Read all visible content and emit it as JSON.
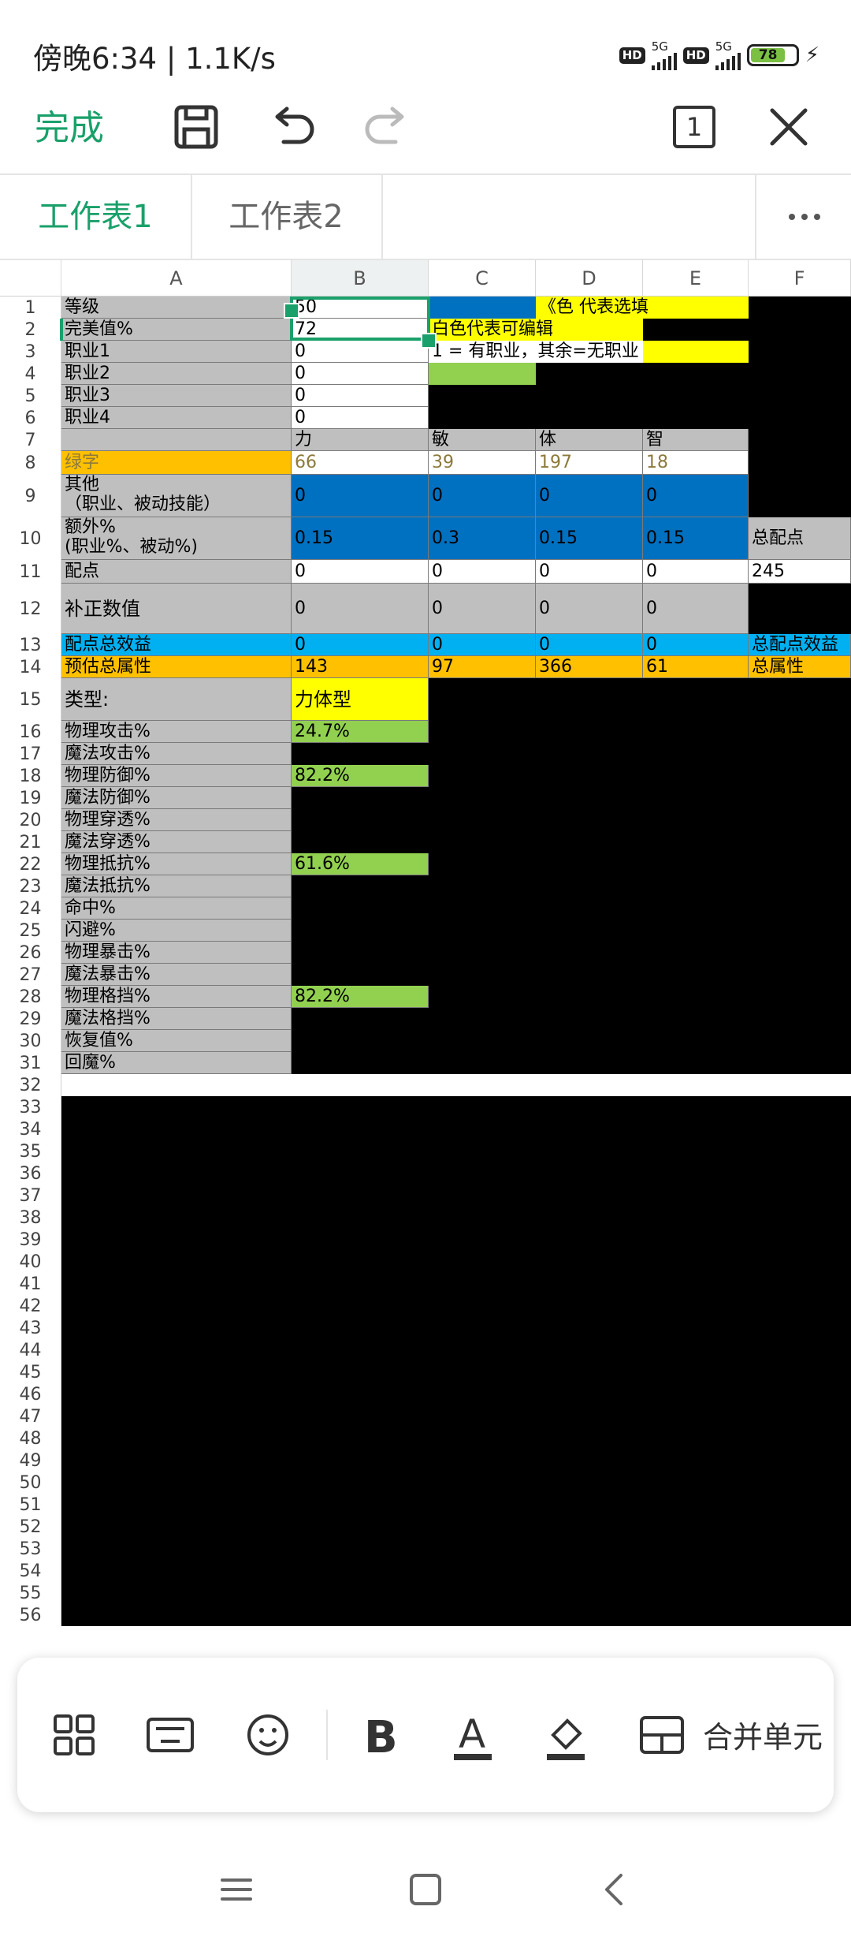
{
  "status_bar": {
    "time": "傍晚6:34 | 1.1K/s",
    "hd1": "HD",
    "net1": "5G",
    "hd2": "HD",
    "net2": "5G",
    "battery": "78"
  },
  "toolbar": {
    "done_label": "完成",
    "page_count": "1"
  },
  "tabs": [
    {
      "label": "工作表1",
      "active": true
    },
    {
      "label": "工作表2",
      "active": false
    }
  ],
  "columns": [
    "A",
    "B",
    "C",
    "D",
    "E",
    "F"
  ],
  "row_numbers": [
    "1",
    "2",
    "3",
    "4",
    "5",
    "6",
    "7",
    "8",
    "9",
    "10",
    "11",
    "12",
    "13",
    "14",
    "15",
    "16",
    "17",
    "18",
    "19",
    "20",
    "21",
    "22",
    "23",
    "24",
    "25",
    "26",
    "27",
    "28",
    "29",
    "30",
    "31",
    "32",
    "33",
    "34",
    "35",
    "36",
    "37",
    "38",
    "39",
    "40",
    "41",
    "42",
    "43",
    "44",
    "45",
    "46",
    "47",
    "48",
    "49",
    "50",
    "51",
    "52",
    "53",
    "54",
    "55",
    "56"
  ],
  "cells": {
    "A1": "等级",
    "B1": "50",
    "D1": "《色 代表选填",
    "A2": "完美值%",
    "B2": "72",
    "C2": "白色代表可编辑",
    "A3": "职业1",
    "B3": "0",
    "C3": "1 = 有职业，其余=无职业",
    "A4": "职业2",
    "B4": "0",
    "A5": "职业3",
    "B5": "0",
    "A6": "职业4",
    "B6": "0",
    "B7": "力",
    "C7": "敏",
    "D7": "体",
    "E7": "智",
    "A8": "绿字",
    "B8": "66",
    "C8": "39",
    "D8": "197",
    "E8": "18",
    "A9": "其他\n（职业、被动技能）",
    "B9": "0",
    "C9": "0",
    "D9": "0",
    "E9": "0",
    "A10": "额外%\n(职业%、被动%)",
    "B10": "0.15",
    "C10": "0.3",
    "D10": "0.15",
    "E10": "0.15",
    "F10": "总配点",
    "A11": "配点",
    "B11": "0",
    "C11": "0",
    "D11": "0",
    "E11": "0",
    "F11": "245",
    "A12": "补正数值",
    "B12": "0",
    "C12": "0",
    "D12": "0",
    "E12": "0",
    "A13": "配点总效益",
    "B13": "0",
    "C13": "0",
    "D13": "0",
    "E13": "0",
    "F13": "总配点效益",
    "A14": "预估总属性",
    "B14": "143",
    "C14": "97",
    "D14": "366",
    "E14": "61",
    "F14": "总属性",
    "A15": "类型:",
    "B15": "力体型",
    "A16": "物理攻击%",
    "B16": "24.7%",
    "A17": "魔法攻击%",
    "A18": "物理防御%",
    "B18": "82.2%",
    "A19": "魔法防御%",
    "A20": "物理穿透%",
    "A21": "魔法穿透%",
    "A22": "物理抵抗%",
    "B22": "61.6%",
    "A23": "魔法抵抗%",
    "A24": "命中%",
    "A25": "闪避%",
    "A26": "物理暴击%",
    "A27": "魔法暴击%",
    "A28": "物理格挡%",
    "B28": "82.2%",
    "A29": "魔法格挡%",
    "A30": "恢复值%",
    "A31": "回魔%"
  },
  "colors": {
    "accent": "#1aa06a",
    "gray": "#bfbfbf",
    "blue": "#0070c0",
    "yellow": "#ffff00",
    "orange": "#ffc000",
    "green": "#92d050",
    "cyan": "#00b0f0"
  },
  "bottom_bar": {
    "icons": [
      "apps-icon",
      "keyboard-icon",
      "emoji-icon",
      "bold-icon",
      "font-color-icon",
      "fill-color-icon",
      "merge-cells-icon"
    ],
    "merge_label": "合并单元"
  },
  "nav": {
    "icons": [
      "menu-icon",
      "home-icon",
      "back-icon"
    ]
  }
}
